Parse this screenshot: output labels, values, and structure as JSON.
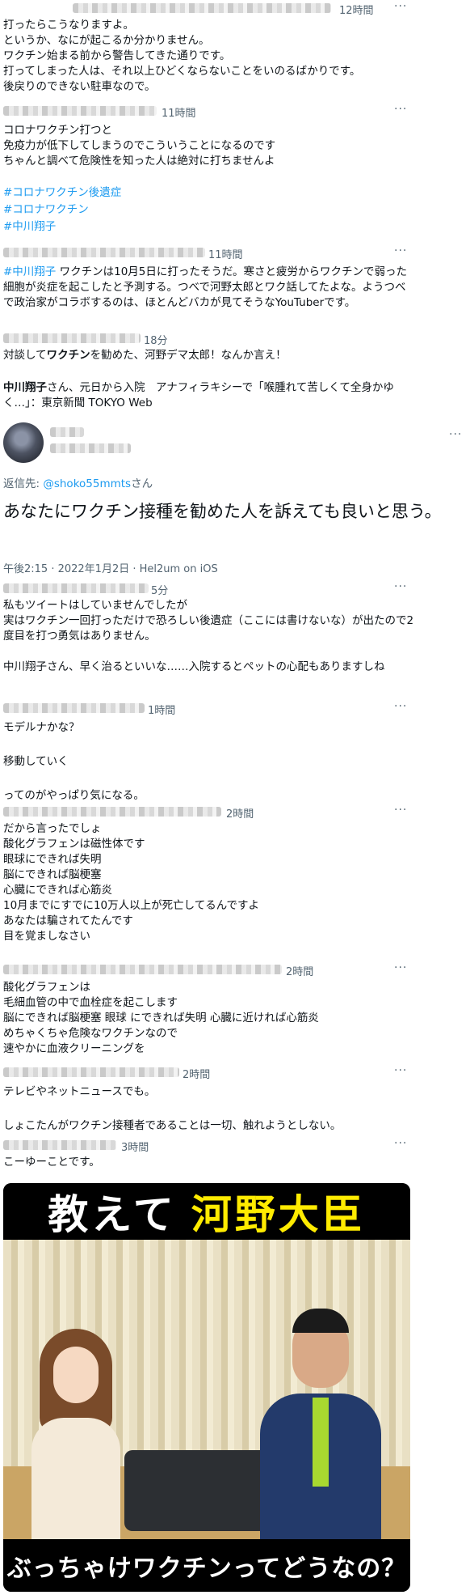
{
  "tweets": {
    "t1": {
      "time": "12時間",
      "lines": "打ったらこうなりますよ。\nというか、なにが起こるか分かりません。\nワクチン始まる前から警告してきた通りです。\n打ってしまった人は、それ以上ひどくならないことをいのるばかりです。\n後戻りのできない駐車なので。"
    },
    "t2": {
      "time": "11時間",
      "lines": "コロナワクチン打つと\n免疫力が低下してしまうのでこういうことになるのです\nちゃんと調べて危険性を知った人は絶対に打ちませんよ",
      "tags": [
        "#コロナワクチン後遺症",
        "#コロナワクチン",
        "#中川翔子"
      ]
    },
    "t3": {
      "time": "11時間",
      "tag": "#中川翔子",
      "lines": " ワクチンは10月5日に打ったそうだ。寒さと疲労からワクチンで弱った細胞が炎症を起こしたと予測する。つべで河野太郎とワク話してたよな。ようつべで政治家がコラボするのは、ほとんどバカが見てそうなYouTuberです。"
    },
    "t4": {
      "time": "18分",
      "pre": "対談して",
      "bold": "ワクチン",
      "post": "を勧めた、河野デマ太郎！なんか言え！",
      "link_bold": "中川翔子",
      "link_rest": "さん、元日から入院　アナフィラキシーで「喉腫れて苦しくて全身かゆく…」：東京新聞 TOKYO Web"
    },
    "main": {
      "reply_prefix": "返信先: ",
      "reply_handle": "@shoko55mmts",
      "reply_suffix": "さん",
      "text": "あなたにワクチン接種を勧めた人を訴えても良いと思う。",
      "meta": "午後2:15 · 2022年1月2日 · Hel2um on iOS"
    },
    "r1": {
      "time": "5分",
      "lines": "私もツイートはしていませんでしたが\n実はワクチン一回打っただけで恐ろしい後遺症（ここには書けないな）が出たので2度目を打つ勇気はありません。\n\n中川翔子さん、早く治るといいな……入院するとペットの心配もありますしね"
    },
    "r2": {
      "time": "1時間",
      "lines": "モデルナかな？\n\n移動していく\n\nってのがやっぱり気になる。"
    },
    "r3": {
      "time": "2時間",
      "lines": "だから言ったでしょ\n酸化グラフェンは磁性体です\n眼球にできれば失明\n脳にできれば脳梗塞\n心臓にできれば心筋炎\n10月までにすでに10万人以上が死亡してるんですよ\nあなたは騙されてたんです\n目を覚ましなさい"
    },
    "r4": {
      "time": "2時間",
      "lines": "酸化グラフェンは\n毛細血管の中で血栓症を起こします\n脳にできれば脳梗塞 眼球 にできれば失明 心臓に近ければ心筋炎\nめちゃくちゃ危険なワクチンなので\n速やかに血液クリーニングを"
    },
    "r5": {
      "time": "2時間",
      "lines": "テレビやネットニュースでも。\n\nしょこたんがワクチン接種者であることは一切、触れようとしない。"
    },
    "r6": {
      "time": "3時間",
      "lines": "こーゆーことです。"
    }
  },
  "thumbnail": {
    "title_white": "教えて",
    "title_yellow": "河野大臣",
    "bottom": "ぶっちゃけワクチンってどうなの？"
  },
  "more": "···"
}
